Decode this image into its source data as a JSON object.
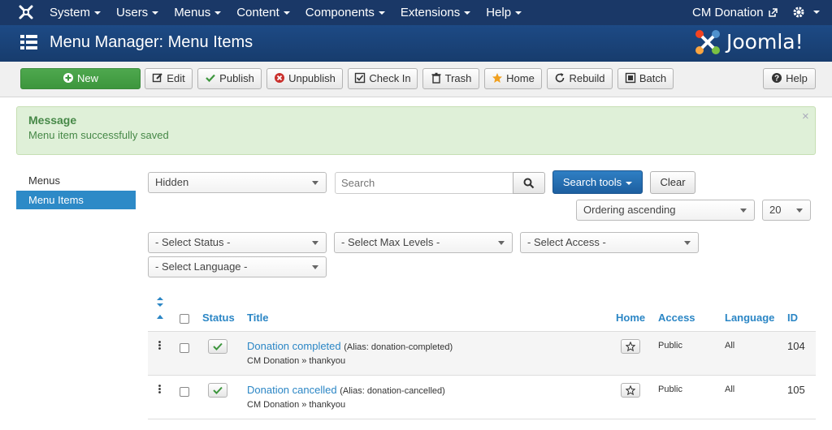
{
  "topnav": {
    "items": [
      "System",
      "Users",
      "Menus",
      "Content",
      "Components",
      "Extensions",
      "Help"
    ],
    "site_name": "CM Donation"
  },
  "header": {
    "title": "Menu Manager: Menu Items",
    "brand": "Joomla!"
  },
  "toolbar": {
    "new": "New",
    "edit": "Edit",
    "publish": "Publish",
    "unpublish": "Unpublish",
    "checkin": "Check In",
    "trash": "Trash",
    "home": "Home",
    "rebuild": "Rebuild",
    "batch": "Batch",
    "help": "Help"
  },
  "message": {
    "heading": "Message",
    "text": "Menu item successfully saved",
    "close": "×"
  },
  "sidebar": {
    "items": [
      "Menus",
      "Menu Items"
    ]
  },
  "filters": {
    "menu": "Hidden",
    "search_placeholder": "Search",
    "search_tools": "Search tools",
    "clear": "Clear",
    "ordering": "Ordering ascending",
    "limit": "20",
    "status": "- Select Status -",
    "max_levels": "- Select Max Levels -",
    "access": "- Select Access -",
    "language": "- Select Language -"
  },
  "table": {
    "headers": {
      "status": "Status",
      "title": "Title",
      "home": "Home",
      "access": "Access",
      "language": "Language",
      "id": "ID"
    },
    "rows": [
      {
        "title": "Donation completed",
        "alias": "(Alias: donation-completed)",
        "path": "CM Donation » thankyou",
        "access": "Public",
        "language": "All",
        "id": "104"
      },
      {
        "title": "Donation cancelled",
        "alias": "(Alias: donation-cancelled)",
        "path": "CM Donation » thankyou",
        "access": "Public",
        "language": "All",
        "id": "105"
      }
    ]
  },
  "colors": {
    "nav": "#1a3867",
    "link": "#2b86c5",
    "success": "#468847",
    "active": "#2d8ac7"
  }
}
